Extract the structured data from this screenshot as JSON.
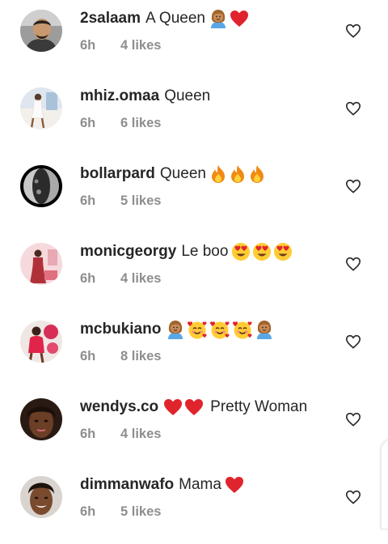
{
  "comments": [
    {
      "username": "2salaam",
      "text": "A Queen",
      "emojis": [
        "woman-icon",
        "red-heart-icon"
      ],
      "time": "6h",
      "likes": "4 likes",
      "avatar": "avatar-man-1"
    },
    {
      "username": "mhiz.omaa",
      "text": "Queen",
      "emojis": [],
      "time": "6h",
      "likes": "6 likes",
      "avatar": "avatar-woman-white-dress"
    },
    {
      "username": "bollarpard",
      "text": "Queen",
      "emojis": [
        "fire-icon",
        "fire-icon",
        "fire-icon"
      ],
      "time": "6h",
      "likes": "5 likes",
      "avatar": "avatar-moon"
    },
    {
      "username": "monicgeorgy",
      "text": "Le boo",
      "emojis": [
        "heart-eyes-icon",
        "heart-eyes-icon",
        "heart-eyes-icon"
      ],
      "time": "6h",
      "likes": "4 likes",
      "avatar": "avatar-pink-room"
    },
    {
      "username": "mcbukiano",
      "text": "",
      "emojis": [
        "woman-icon",
        "smiling-hearts-icon",
        "smiling-hearts-icon",
        "smiling-hearts-icon",
        "woman-icon"
      ],
      "time": "6h",
      "likes": "8 likes",
      "avatar": "avatar-red-outfit"
    },
    {
      "username": "wendys.co",
      "text": "Pretty Woman",
      "emojis": [
        "red-heart-icon",
        "red-heart-icon"
      ],
      "text_after_emojis": true,
      "time": "6h",
      "likes": "4 likes",
      "avatar": "avatar-woman-closeup"
    },
    {
      "username": "dimmanwafo",
      "text": "Mama",
      "emojis": [
        "red-heart-icon"
      ],
      "time": "6h",
      "likes": "5 likes",
      "avatar": "avatar-woman-smile"
    }
  ],
  "colors": {
    "username": "#262626",
    "meta": "#8e8e8e",
    "heart_outline": "#262626",
    "red_heart": "#e0242d",
    "fire": "#f08a12"
  },
  "like_action_icon": "heart-outline-icon"
}
